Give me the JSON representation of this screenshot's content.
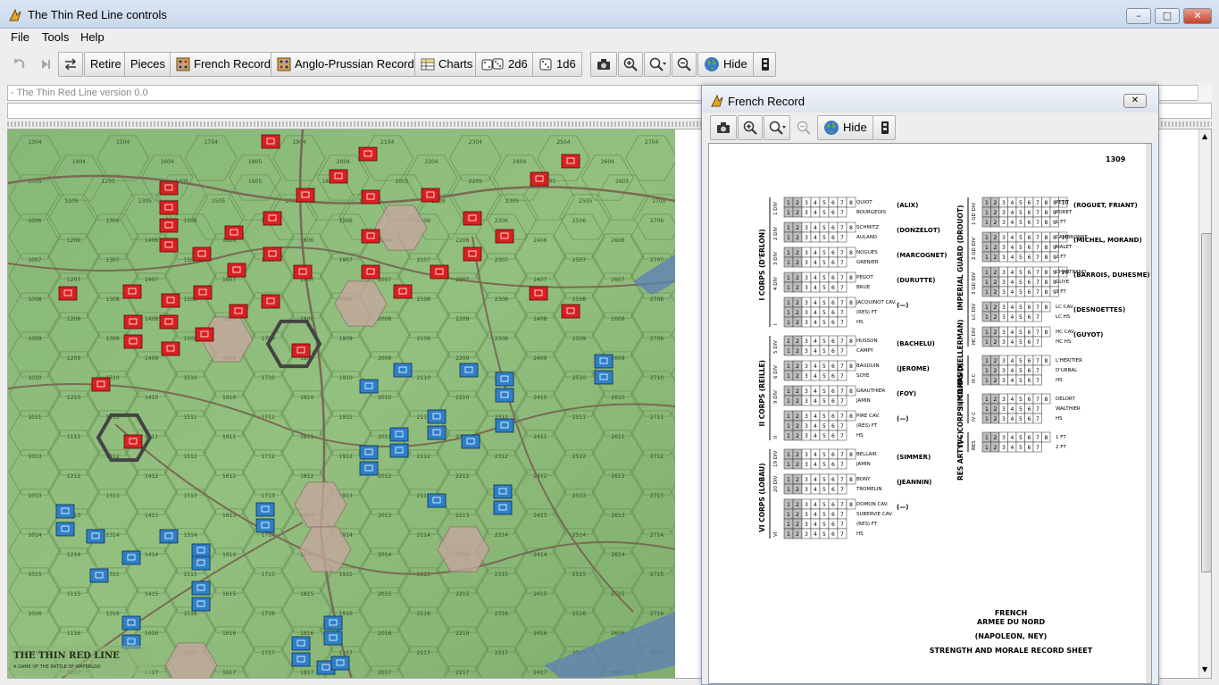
{
  "window": {
    "title": "The Thin Red Line controls"
  },
  "menu": {
    "file": "File",
    "tools": "Tools",
    "help": "Help"
  },
  "toolbar": {
    "retire": "Retire",
    "pieces": "Pieces",
    "french_record": "French Record",
    "anglo_prussian_record": "Anglo-Prussian Record",
    "charts": "Charts",
    "dice_2d6": "2d6",
    "dice_1d6": "1d6",
    "hide": "Hide"
  },
  "status": {
    "version_text": "- The Thin Red Line version 0.0"
  },
  "map": {
    "title": "THE THIN RED LINE",
    "subtitle": "A GAME OF THE BATTLE OF WATERLOO",
    "hex_labels": {
      "r1": [
        "1304",
        "1404",
        "1504",
        "1604",
        "1704",
        "1805",
        "1904",
        "2004",
        "2104",
        "2204",
        "2304",
        "2404",
        "2504",
        "2604",
        "2704"
      ],
      "r2": [
        "1005",
        "1105",
        "1205",
        "1305",
        "1405",
        "1505",
        "1605",
        "1705",
        "1805",
        "1905",
        "2005",
        "2105",
        "2205",
        "2305",
        "2405",
        "2505",
        "2605",
        "2705"
      ],
      "r3": [
        "1006",
        "1206",
        "1306",
        "1406",
        "1506",
        "1606",
        "1706",
        "1806",
        "1906",
        "2006",
        "2106",
        "2206",
        "2306",
        "2406",
        "2506",
        "2606",
        "2706"
      ],
      "r4": [
        "1007",
        "1207",
        "1307",
        "1407",
        "1507",
        "1607",
        "1707",
        "1807",
        "1907",
        "2007",
        "2107",
        "2207",
        "2307",
        "2407",
        "2507",
        "2607",
        "2707"
      ],
      "r5": [
        "1008",
        "1208",
        "1308",
        "1408",
        "1508",
        "1608",
        "1708",
        "1808",
        "1908",
        "2008",
        "2108",
        "2208",
        "2308",
        "2408",
        "2508",
        "2608",
        "2708"
      ],
      "r6": [
        "1009",
        "1209",
        "1309",
        "1409",
        "1509",
        "1609",
        "1709",
        "1809",
        "1909",
        "2009",
        "2109",
        "2209",
        "2309",
        "2409",
        "2509",
        "2609",
        "2709"
      ],
      "r7": [
        "1010",
        "1210",
        "1310",
        "1410",
        "1510",
        "1610",
        "1710",
        "1810",
        "1910",
        "2010",
        "2110",
        "2210",
        "2310",
        "2410",
        "2510",
        "2610",
        "2710"
      ],
      "r8": [
        "1011",
        "1111",
        "1311",
        "1411",
        "1511",
        "1611",
        "1711",
        "1811",
        "1911",
        "2011",
        "2111",
        "2211",
        "2311",
        "2411",
        "2511",
        "2611",
        "2711"
      ],
      "r9": [
        "1013",
        "1212",
        "1312",
        "1412",
        "1512",
        "1612",
        "1712",
        "1812",
        "1912",
        "2012",
        "2112",
        "2212",
        "2312",
        "2412",
        "2512",
        "2612",
        "2712"
      ],
      "r10": [
        "1013",
        "1213",
        "1313",
        "1413",
        "1513",
        "1613",
        "1713",
        "1813",
        "1913",
        "2013",
        "2113",
        "2213",
        "2313",
        "2413",
        "2513",
        "2613",
        "2713"
      ],
      "r11": [
        "1014",
        "1214",
        "1314",
        "1414",
        "1514",
        "1614",
        "1714",
        "1814",
        "1914",
        "2014",
        "2114",
        "2214",
        "2314",
        "2414",
        "2514",
        "2614",
        "2714"
      ],
      "r12": [
        "1015",
        "1115",
        "1315",
        "1415",
        "1515",
        "1615",
        "1715",
        "1815",
        "1915",
        "2015",
        "2115",
        "2215",
        "2315",
        "2415",
        "2515",
        "2615",
        "2715"
      ],
      "r13": [
        "1016",
        "1116",
        "1316",
        "1416",
        "1516",
        "1616",
        "1716",
        "1816",
        "1916",
        "2016",
        "2116",
        "2216",
        "2316",
        "2416",
        "2516",
        "2616",
        "2716"
      ],
      "r14": [
        "1017",
        "1217",
        "1317",
        "1417",
        "1517",
        "1617",
        "1717",
        "1817",
        "1917",
        "2017",
        "2117",
        "2217",
        "2317",
        "2417",
        "2517",
        "2617",
        "2717"
      ]
    }
  },
  "french_record": {
    "window_title": "French Record",
    "hide": "Hide",
    "page_number": "1309",
    "left_corps": [
      {
        "corps": "I CORPS (D'ERLON)",
        "units": [
          {
            "div": "1 DIV",
            "brigades": [
              "QUIOT",
              "BOURGEOIS"
            ],
            "commander": "(ALIX)"
          },
          {
            "div": "2 DIV",
            "brigades": [
              "SCHMITZ",
              "AULAND"
            ],
            "commander": "(DONZELOT)"
          },
          {
            "div": "3 DIV",
            "brigades": [
              "NOGUES",
              "GRENIER"
            ],
            "commander": "(MARCOGNET)"
          },
          {
            "div": "4 DIV",
            "brigades": [
              "PEGOT",
              "BRUE"
            ],
            "commander": "(DURUTTE)"
          },
          {
            "div": "I",
            "brigades": [
              "JACQUINOT CAV.",
              "(RES) FT",
              "HS"
            ],
            "commander": "(—)"
          }
        ]
      },
      {
        "corps": "II CORPS (REILLE)",
        "units": [
          {
            "div": "5 DIV",
            "brigades": [
              "HUSSON",
              "CAMPY"
            ],
            "commander": "(BACHELU)"
          },
          {
            "div": "6 DIV",
            "brigades": [
              "BAUDUIN",
              "SOYE"
            ],
            "commander": "(JEROME)"
          },
          {
            "div": "9 DIV",
            "brigades": [
              "GRAUTHIER",
              "JAMIN"
            ],
            "commander": "(FOY)"
          },
          {
            "div": "II",
            "brigades": [
              "PIRE CAV.",
              "(RES) FT",
              "HS"
            ],
            "commander": "(—)"
          }
        ]
      },
      {
        "corps": "VI CORPS (LOBAU)",
        "units": [
          {
            "div": "19 DIV",
            "brigades": [
              "BELLAIR",
              "JAMIN"
            ],
            "commander": "(SIMMER)"
          },
          {
            "div": "20 DIV",
            "brigades": [
              "BONY",
              "TROMELIN"
            ],
            "commander": "(JEANNIN)"
          },
          {
            "div": "VI",
            "brigades": [
              "DOMON CAV.",
              "SUBERVIE CAV.",
              "(RES) FT",
              "HS"
            ],
            "commander": "(—)"
          }
        ]
      }
    ],
    "right_corps": [
      {
        "corps": "IMPERIAL GUARD (DROUOT)",
        "units": [
          {
            "div": "1 GD DIV",
            "brigades": [
              "PETIT",
              "PORET",
              "1 FT"
            ],
            "commander": "(ROGUET, FRIANT)"
          },
          {
            "div": "2 GD DIV",
            "brigades": [
              "CAMBRONNE",
              "MALET",
              "2 FT"
            ],
            "commander": "(MICHEL, MORAND)"
          },
          {
            "div": "3 GD DIV",
            "brigades": [
              "CHARTRAND",
              "GUYE",
              "3 FT"
            ],
            "commander": "(BARROIS, DUHESME)"
          },
          {
            "div": "LC DIV",
            "brigades": [
              "LC CAV.",
              "LC HS"
            ],
            "commander": "(DESNOETTES)"
          },
          {
            "div": "HC DIV",
            "brigades": [
              "HC CAV.",
              "HC HS"
            ],
            "commander": "(GUYOT)"
          }
        ]
      },
      {
        "corps": "III CORPS (KELLERMAN)",
        "units": [
          {
            "div": "III C",
            "brigades": [
              "L'HERITIER",
              "D'URBAL",
              "HS"
            ],
            "commander": ""
          }
        ]
      },
      {
        "corps": "IVC CORPS (MILHAUD)",
        "units": [
          {
            "div": "IV C",
            "brigades": [
              "DELORT",
              "WALTHIER",
              "HS"
            ],
            "commander": ""
          }
        ]
      },
      {
        "corps": "RES ARTY(—)",
        "units": [
          {
            "div": "RES",
            "brigades": [
              "1 FT",
              "2 FT"
            ],
            "commander": ""
          }
        ]
      }
    ],
    "footer": {
      "line1": "FRENCH",
      "line2": "ARMEE DU NORD",
      "line3": "(NAPOLEON, NEY)",
      "line4": "STRENGTH AND MORALE RECORD SHEET"
    }
  },
  "colors": {
    "french_counter": "#d82020",
    "allied_counter": "#2f7fc8",
    "map_green": "#8fbc7a",
    "highlight_hex": "#c9a6a0"
  }
}
